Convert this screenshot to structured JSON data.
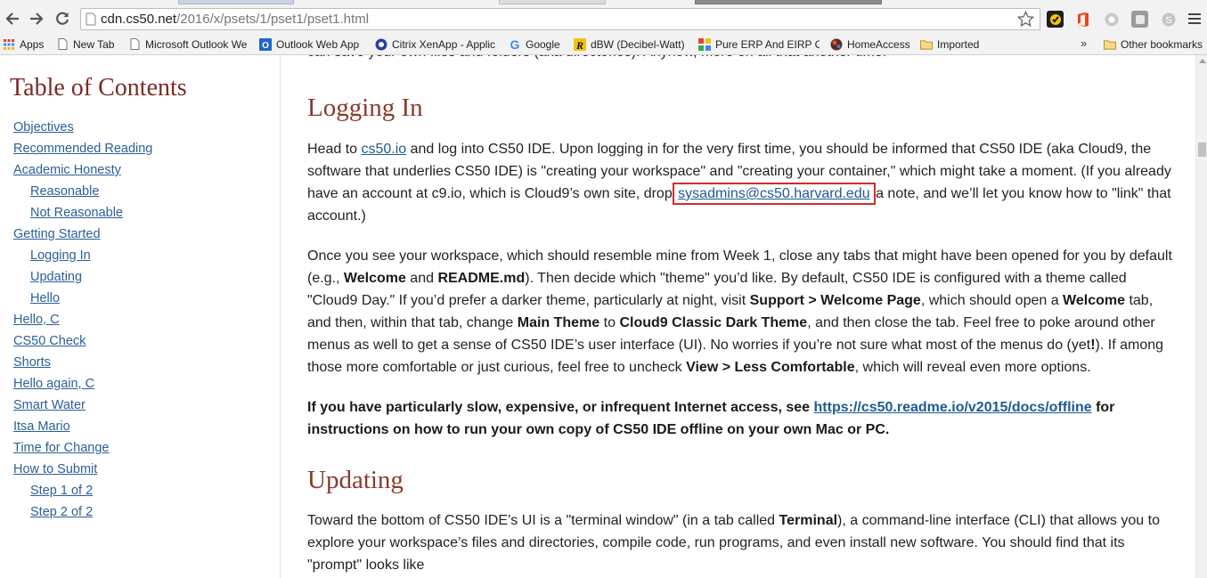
{
  "browser": {
    "url_host": "cdn.cs50.net",
    "url_path": "/2016/x/psets/1/pset1/pset1.html",
    "bookmarks": [
      {
        "label": "Apps",
        "icon": "apps-grid-icon"
      },
      {
        "label": "New Tab",
        "icon": "page-icon"
      },
      {
        "label": "Microsoft Outlook We",
        "icon": "page-icon"
      },
      {
        "label": "Outlook Web App",
        "icon": "outlook-icon"
      },
      {
        "label": "Citrix XenApp - Applic",
        "icon": "citrix-icon"
      },
      {
        "label": "Google",
        "icon": "google-icon"
      },
      {
        "label": "dBW (Decibel-Watt)",
        "icon": "dbw-icon"
      },
      {
        "label": "Pure ERP And EIRP Ca",
        "icon": "erp-icon"
      },
      {
        "label": "HomeAccess",
        "icon": "homeaccess-icon"
      },
      {
        "label": "Imported",
        "icon": "folder-icon"
      }
    ],
    "more_label": "»",
    "other_bookmarks": "Other bookmarks"
  },
  "toc": {
    "title": "Table of Contents",
    "items": [
      {
        "label": "Objectives",
        "level": 0
      },
      {
        "label": "Recommended Reading",
        "level": 0
      },
      {
        "label": "Academic Honesty",
        "level": 0
      },
      {
        "label": "Reasonable",
        "level": 1
      },
      {
        "label": "Not Reasonable",
        "level": 1
      },
      {
        "label": "Getting Started",
        "level": 0
      },
      {
        "label": "Logging In",
        "level": 1
      },
      {
        "label": "Updating",
        "level": 1
      },
      {
        "label": "Hello",
        "level": 1
      },
      {
        "label": "Hello, C",
        "level": 0
      },
      {
        "label": "CS50 Check",
        "level": 0
      },
      {
        "label": "Shorts",
        "level": 0
      },
      {
        "label": "Hello again, C",
        "level": 0
      },
      {
        "label": "Smart Water",
        "level": 0
      },
      {
        "label": "Itsa Mario",
        "level": 0
      },
      {
        "label": "Time for Change",
        "level": 0
      },
      {
        "label": "How to Submit",
        "level": 0
      },
      {
        "label": "Step 1 of 2",
        "level": 1
      },
      {
        "label": "Step 2 of 2",
        "level": 1
      }
    ]
  },
  "content": {
    "clipped_line": "can save your own files and folders (aka directories). Anyhow, more on all that another time!",
    "logging_in": {
      "heading": "Logging In",
      "p1": {
        "t1": "Head to ",
        "link1": "cs50.io",
        "t2": " and log into CS50 IDE. Upon logging in for the very first time, you should be informed that CS50 IDE (aka Cloud9, the software that underlies CS50 IDE) is \"creating your workspace\" and \"creating your container,\" which might take a moment. (If you already have an account at c9.io, which is Cloud9’s own site, drop ",
        "email": "sysadmins@cs50.harvard.edu",
        "t3": " a note, and we’ll let you know how to \"link\" that account.)"
      },
      "p2": {
        "t1": "Once you see your workspace, which should resemble mine from Week 1, close any tabs that might have been opened for you by default (e.g., ",
        "b1": "Welcome",
        "t2": " and ",
        "b2": "README.md",
        "t3": "). Then decide which \"theme\" you’d like. By default, CS50 IDE is configured with a theme called \"Cloud9 Day.\" If you’d prefer a darker theme, particularly at night, visit ",
        "b3": "Support > Welcome Page",
        "t4": ", which should open a ",
        "b4": "Welcome",
        "t5": " tab, and then, within that tab, change ",
        "b5": "Main Theme",
        "t6": " to ",
        "b6": "Cloud9 Classic Dark Theme",
        "t7": ", and then close the tab. Feel free to poke around other menus as well to get a sense of CS50 IDE’s user interface (UI). No worries if you’re not sure what most of the menus do (yet",
        "b7": "!",
        "t8": "). If among those more comfortable or just curious, feel free to uncheck ",
        "b8": "View > Less Comfortable",
        "t9": ", which will reveal even more options."
      },
      "p3": {
        "b1": "If you have particularly slow, expensive, or infrequent Internet access, see ",
        "link": "https://cs50.readme.io/v2015/docs/offline",
        "b2": " for instructions on how to run your own copy of CS50 IDE offline on your own Mac or PC."
      }
    },
    "updating": {
      "heading": "Updating",
      "p1": {
        "t1": "Toward the bottom of CS50 IDE’s UI is a \"terminal window\" (in a tab called ",
        "b1": "Terminal",
        "t2": "), a command-line interface (CLI) that allows you to explore your workspace’s files and directories, compile code, run programs, and even install new software. You should find that its \"prompt\" looks like"
      }
    }
  },
  "colors": {
    "heading": "#8b3a2c",
    "toc_title": "#7a2b23",
    "link": "#1d5a94",
    "highlight_box": "#d02b2b"
  }
}
